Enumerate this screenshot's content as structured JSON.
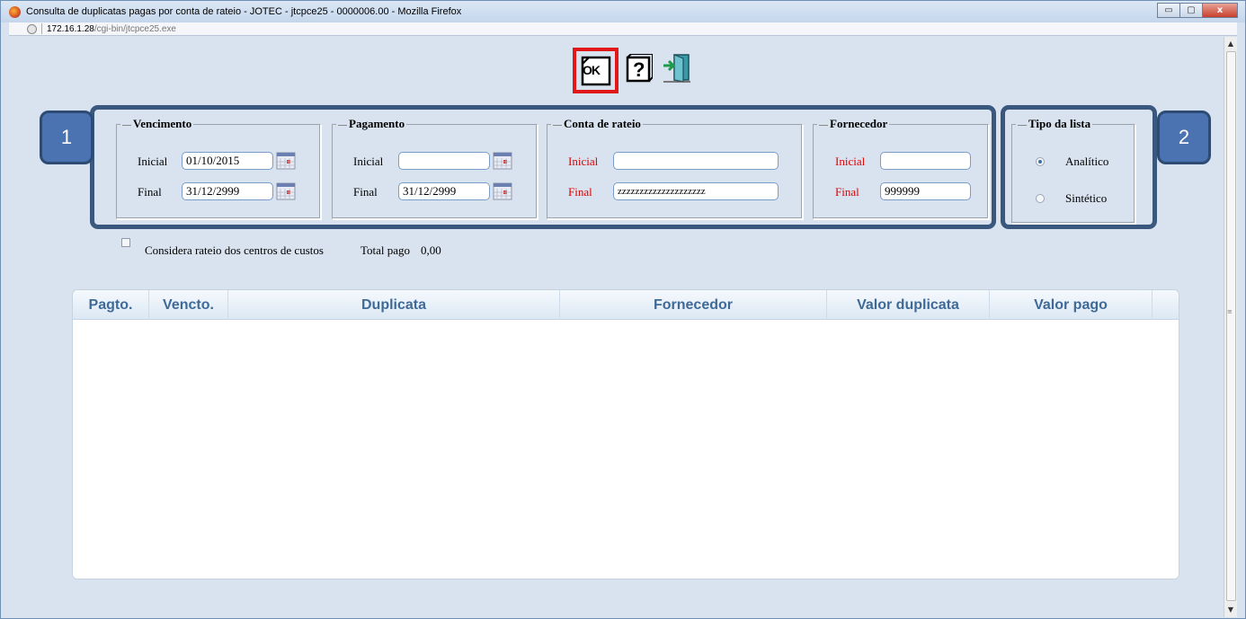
{
  "window": {
    "title": "Consulta de duplicatas pagas por conta de rateio - JOTEC - jtcpce25 - 0000006.00 - Mozilla Firefox",
    "controls": {
      "minimize": "▭",
      "maximize": "▢",
      "close": "x"
    }
  },
  "address": {
    "host": "172.16.1.28",
    "path": "/cgi-bin/jtcpce25.exe"
  },
  "toolbar": {
    "ok_label": "OK",
    "help_label": "?"
  },
  "badges": {
    "one": "1",
    "two": "2"
  },
  "vencimento": {
    "legend": "Vencimento",
    "inicial_label": "Inicial",
    "inicial_value": "01/10/2015",
    "final_label": "Final",
    "final_value": "31/12/2999"
  },
  "pagamento": {
    "legend": "Pagamento",
    "inicial_label": "Inicial",
    "inicial_value": "",
    "final_label": "Final",
    "final_value": "31/12/2999"
  },
  "conta": {
    "legend": "Conta de rateio",
    "inicial_label": "Inicial",
    "inicial_value": "",
    "final_label": "Final",
    "final_value": "zzzzzzzzzzzzzzzzzzzz"
  },
  "fornecedor": {
    "legend": "Fornecedor",
    "inicial_label": "Inicial",
    "inicial_value": "",
    "final_label": "Final",
    "final_value": "999999"
  },
  "tipo": {
    "legend": "Tipo da lista",
    "analitico": "Analítico",
    "sintetico": "Sintético",
    "selected": "Analítico"
  },
  "options": {
    "considera_label": "Considera rateio dos centros de custos",
    "total_label": "Total pago",
    "total_value": "0,00"
  },
  "grid": {
    "columns": [
      "Pagto.",
      "Vencto.",
      "Duplicata",
      "Fornecedor",
      "Valor duplicata",
      "Valor pago"
    ],
    "rows": []
  },
  "colors": {
    "callout": "#3a577d",
    "badge": "#4b72b1",
    "highlight": "#e01818",
    "required_label": "#e00000",
    "header_text": "#3f6a98"
  }
}
